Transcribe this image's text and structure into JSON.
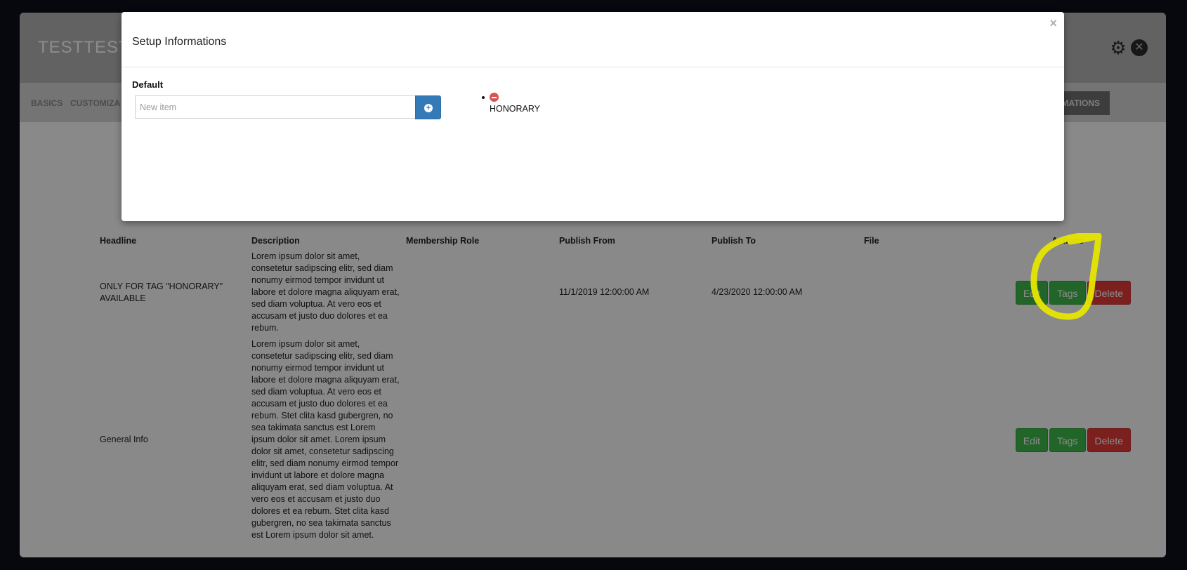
{
  "app": {
    "title": "TESTTEST"
  },
  "nav": {
    "items": [
      "BASICS",
      "CUSTOMIZA"
    ],
    "active": "MATIONS"
  },
  "table": {
    "columns": [
      "Headline",
      "Description",
      "Membership Role",
      "Publish From",
      "Publish To",
      "File",
      "Actions"
    ],
    "rows": [
      {
        "headline": "ONLY FOR TAG \"HONORARY\" AVAILABLE",
        "description": "Lorem ipsum dolor sit amet, consetetur sadipscing elitr, sed diam nonumy eirmod tempor invidunt ut labore et dolore magna aliquyam erat, sed diam voluptua. At vero eos et accusam et justo duo dolores et ea rebum.",
        "role": "",
        "publish_from": "11/1/2019 12:00:00 AM",
        "publish_to": "4/23/2020 12:00:00 AM",
        "file": ""
      },
      {
        "headline": "General Info",
        "description": "Lorem ipsum dolor sit amet, consetetur sadipscing elitr, sed diam nonumy eirmod tempor invidunt ut labore et dolore magna aliquyam erat, sed diam voluptua. At vero eos et accusam et justo duo dolores et ea rebum. Stet clita kasd gubergren, no sea takimata sanctus est Lorem ipsum dolor sit amet. Lorem ipsum dolor sit amet, consetetur sadipscing elitr, sed diam nonumy eirmod tempor invidunt ut labore et dolore magna aliquyam erat, sed diam voluptua. At vero eos et accusam et justo duo dolores et ea rebum. Stet clita kasd gubergren, no sea takimata sanctus est Lorem ipsum dolor sit amet.",
        "role": "",
        "publish_from": "",
        "publish_to": "",
        "file": ""
      }
    ],
    "actions": {
      "edit": "Edit",
      "tags": "Tags",
      "delete": "Delete"
    }
  },
  "modal": {
    "title": "Setup Informations",
    "close": "×",
    "field_label": "Default",
    "input": {
      "value": "",
      "placeholder": "New item"
    },
    "tags": [
      "HONORARY"
    ]
  },
  "colors": {
    "primary": "#337ab7",
    "success": "#3fb84a",
    "danger": "#e03a3a",
    "highlight": "#e6e600"
  }
}
